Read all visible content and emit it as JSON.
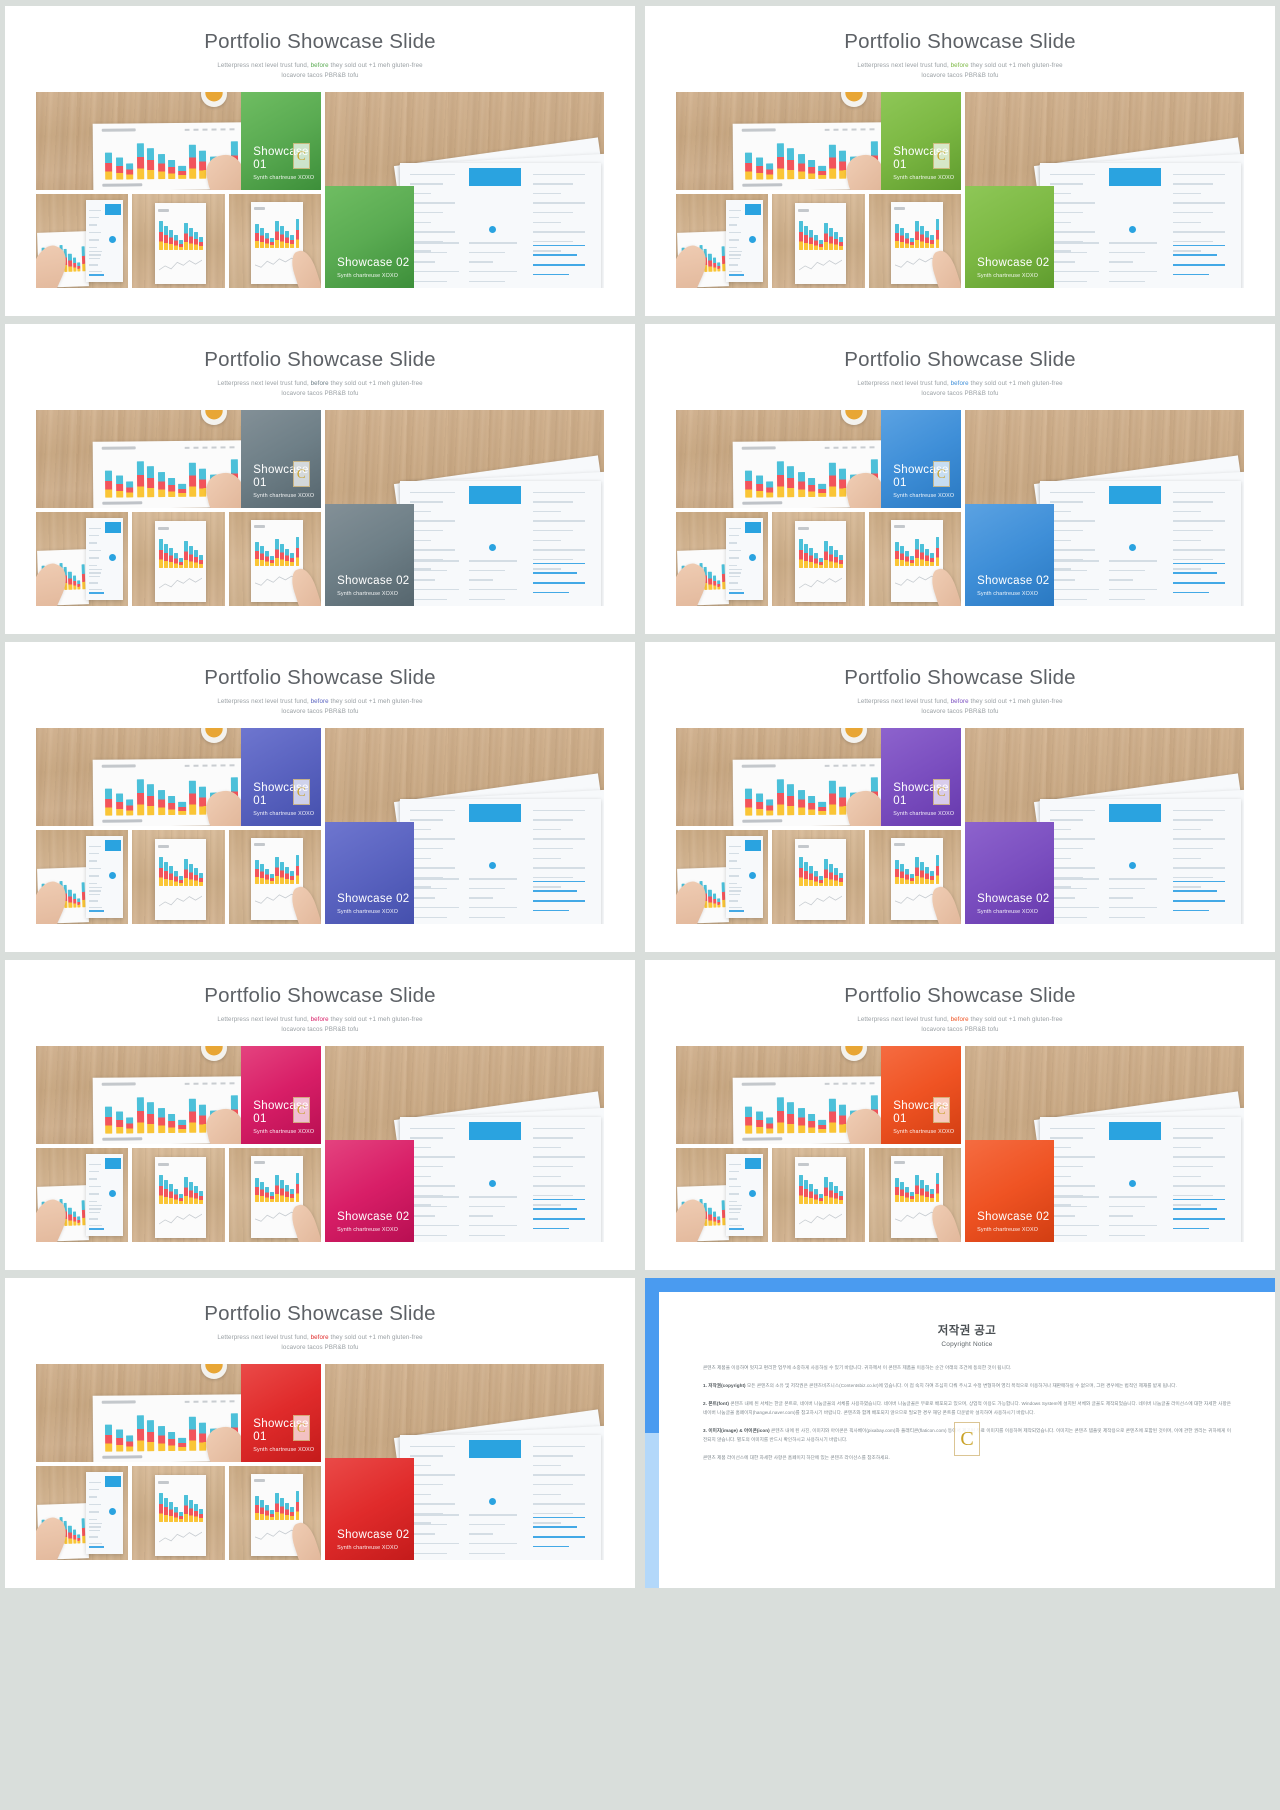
{
  "slide_common": {
    "title": "Portfolio Showcase Slide",
    "subtitle_pre": "Letterpress next level trust fund, ",
    "subtitle_hl": "before",
    "subtitle_post": " they sold out +1 meh gluten-free locavore tacos PBR&B tofu",
    "showcase_01_title": "Showcase 01",
    "showcase_01_sub": "Synth chartreuse XOXO",
    "showcase_02_title": "Showcase 02",
    "showcase_02_sub": "Synth chartreuse XOXO",
    "watermark_glyph": "C"
  },
  "slides": [
    {
      "id": "slide-green",
      "accent": "#5aab52",
      "accent_light": "#6fbd62",
      "accent_dark": "#3d8f3a",
      "name": "green"
    },
    {
      "id": "slide-lime",
      "accent": "#7cb843",
      "accent_light": "#8ec757",
      "accent_dark": "#5f9c2e",
      "name": "lime"
    },
    {
      "id": "slide-slate",
      "accent": "#6e7f87",
      "accent_light": "#839097",
      "accent_dark": "#56666e",
      "name": "slate"
    },
    {
      "id": "slide-blue",
      "accent": "#3f8fd8",
      "accent_light": "#5ba2e2",
      "accent_dark": "#2a79c2",
      "name": "blue"
    },
    {
      "id": "slide-indigo",
      "accent": "#5a63c0",
      "accent_light": "#6e76cf",
      "accent_dark": "#4550ad",
      "name": "indigo"
    },
    {
      "id": "slide-purple",
      "accent": "#7b4fc0",
      "accent_light": "#8d63cd",
      "accent_dark": "#6739ad",
      "name": "purple"
    },
    {
      "id": "slide-magenta",
      "accent": "#d81e67",
      "accent_light": "#e4437f",
      "accent_dark": "#b80f52",
      "name": "magenta"
    },
    {
      "id": "slide-orange",
      "accent": "#ef5323",
      "accent_light": "#f56c41",
      "accent_dark": "#d23e12",
      "name": "orange"
    },
    {
      "id": "slide-red",
      "accent": "#e02b2b",
      "accent_light": "#ea4a48",
      "accent_dark": "#c41b1b",
      "name": "red"
    }
  ],
  "notice": {
    "title": "저작권 공고",
    "subtitle": "Copyright Notice",
    "mark_glyph": "C",
    "paragraphs": [
      "콘텐츠 제품을 이용하여 멋지고 편리한 업무에 소중하게 사용하실 수 있기 바랍니다. 귀하께서 이 콘텐츠 제품을 이용하는 순간 아래의 조건에 동의한 것이 됩니다.",
      "<b>1. 저작권(copyright)</b> 모든 콘텐츠의 소유 및 저작권은 콘텐츠비즈니스(Contentsbiz.co.kr)에 있습니다. 이 점 숙지 하여 조심히 다뤄 주시고 수정 변형하여 영리 목적으로 이용하거나 재판매하실 수 없으며, 그런 경우에는 법적인 제재를 받게 됩니다.",
      "<b>2. 폰트(font)</b> 콘텐츠 내에 된 서체는 한글 폰트로, 네이버 나눔글꼴의 서체를 사용하였습니다. 네이버 나눔글꼴은 무료로 배포되고 있으며, 상업적 이용도 가능합니다. Windows System에 설치된 서체와 글꼴도 제작되었습니다. 네이버 나눔글꼴 라이선스에 대한 자세한 사항은 네이버 나눔글꼴 홈페이지(hangeul.naver.com)를 참고하시기 바랍니다. 콘텐츠와 함께 배포되지 않으므로 필요한 경우 해당 폰트를 다운받아 설치하여 사용하시기 바랍니다.",
      "<b>3. 이미지(image) & 아이콘(icon)</b> 콘텐츠 내에 된 사진, 이미지와 아이콘은 픽사베이(pixabay.com)와 플래티콘(flaticon.com) 등에서 제공된 무료 이미지를 이용하여 제작되었습니다. 이미지는 콘텐츠 템플릿 제작용으로 콘텐츠에 포함된 것이며, 이에 관한 권리는 귀하에게 이전되지 않습니다. 별도의 이미지를 반드시 확인하시고 사용하시기 바랍니다.",
      "콘텐츠 제품 라이선스에 대한 자세한 사항은 홈페이지 하단에 있는 콘텐츠 라이선스를 참조하세요."
    ]
  }
}
